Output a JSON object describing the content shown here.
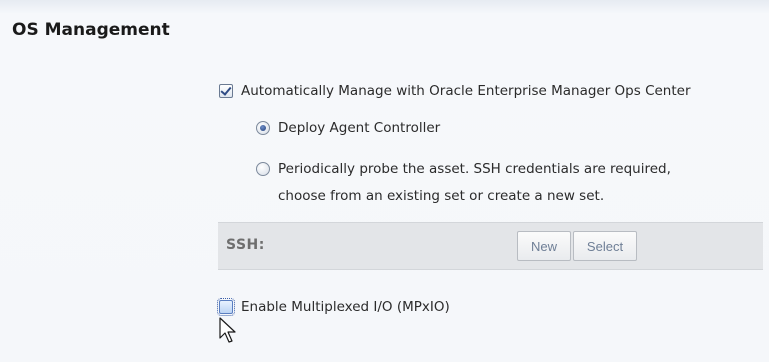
{
  "section": {
    "title": "OS Management"
  },
  "auto_manage": {
    "label": "Automatically Manage with Oracle Enterprise Manager Ops Center",
    "checked": true
  },
  "options": {
    "deploy_agent": {
      "label": "Deploy Agent Controller",
      "selected": true
    },
    "probe": {
      "line1": "Periodically probe the asset. SSH credentials are required,",
      "line2": "choose from an existing set or create a new set.",
      "selected": false
    }
  },
  "ssh": {
    "label": "SSH:",
    "new_label": "New",
    "select_label": "Select"
  },
  "mpxio": {
    "label": "Enable Multiplexed I/O (MPxIO)",
    "checked": false
  },
  "icons": {
    "cursor": "mouse-pointer-icon"
  }
}
